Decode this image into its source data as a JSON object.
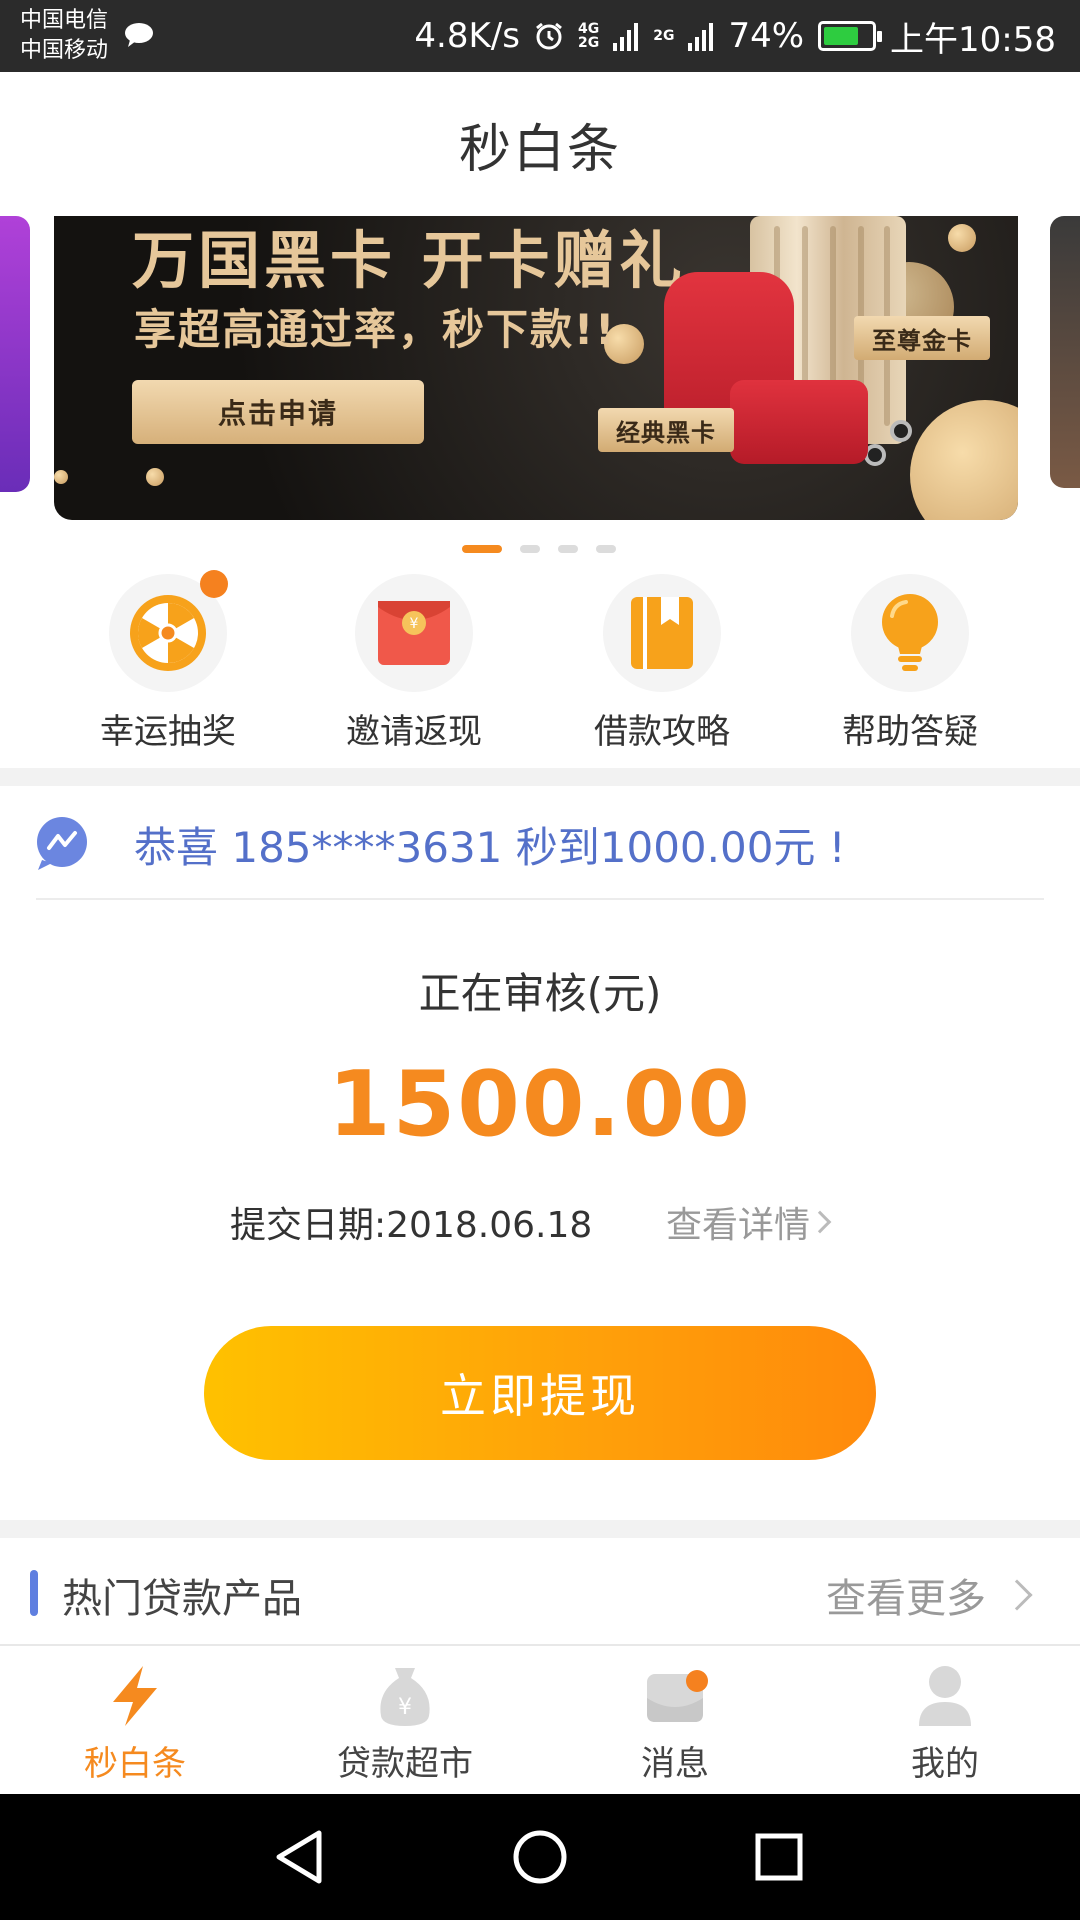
{
  "status_bar": {
    "carrier_1": "中国电信",
    "carrier_2": "中国移动",
    "speed": "4.8K/s",
    "net_1_top": "4G",
    "net_1_bottom": "2G",
    "net_2": "2G",
    "battery": "74%",
    "time": "上午10:58",
    "battery_level": 0.74
  },
  "app": {
    "title": "秒白条"
  },
  "banner": {
    "headline": "万国黑卡  开卡赠礼",
    "subline": "享超高通过率，秒下款!!",
    "cta": "点击申请",
    "tag_gold": "至尊金卡",
    "tag_black": "经典黑卡",
    "pager_count": 4,
    "pager_active": 0
  },
  "quick_menu": [
    {
      "label": "幸运抽奖",
      "icon": "lucky-wheel-icon"
    },
    {
      "label": "邀请返现",
      "icon": "red-envelope-icon"
    },
    {
      "label": "借款攻略",
      "icon": "guide-book-icon"
    },
    {
      "label": "帮助答疑",
      "icon": "lightbulb-icon"
    }
  ],
  "notice": {
    "text": "恭喜 185****3631 秒到1000.00元 !"
  },
  "review": {
    "label": "正在审核(元)",
    "amount": "1500.00",
    "submit_date": "提交日期:2018.06.18",
    "details_link": "查看详情",
    "withdraw_button": "立即提现"
  },
  "hot_products": {
    "title": "热门贷款产品",
    "more": "查看更多"
  },
  "tabs": [
    {
      "label": "秒白条",
      "icon": "lightning-icon",
      "active": true
    },
    {
      "label": "贷款超市",
      "icon": "money-bag-icon",
      "active": false
    },
    {
      "label": "消息",
      "icon": "message-icon",
      "active": false
    },
    {
      "label": "我的",
      "icon": "user-icon",
      "active": false
    }
  ],
  "colors": {
    "accent": "#f58a1f",
    "notice_blue": "#5470c9",
    "button_start": "#ffc100",
    "button_end": "#ff8a0b"
  }
}
